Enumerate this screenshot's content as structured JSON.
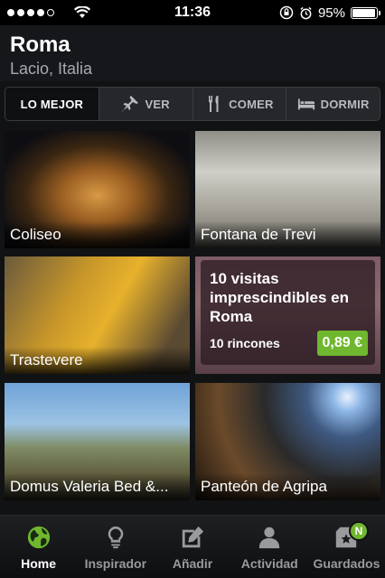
{
  "status_bar": {
    "time": "11:36",
    "battery": "95%",
    "battery_level": 0.95
  },
  "header": {
    "city": "Roma",
    "region": "Lacio, Italia"
  },
  "tabs": [
    {
      "label": "LO MEJOR",
      "icon": "none",
      "active": true
    },
    {
      "label": "VER",
      "icon": "pin-icon",
      "active": false
    },
    {
      "label": "COMER",
      "icon": "fork-knife-icon",
      "active": false
    },
    {
      "label": "DORMIR",
      "icon": "bed-icon",
      "active": false
    }
  ],
  "tiles": [
    {
      "label": "Coliseo"
    },
    {
      "label": "Fontana de Trevi"
    },
    {
      "label": "Trastevere"
    },
    {
      "promo_title": "10 visitas imprescindibles en Roma",
      "count": "10 rincones",
      "price": "0,89 €"
    },
    {
      "label": "Domus Valeria Bed &..."
    },
    {
      "label": "Panteón de Agripa"
    }
  ],
  "tabbar": [
    {
      "label": "Home",
      "icon": "globe-icon",
      "active": true
    },
    {
      "label": "Inspirador",
      "icon": "lightbulb-icon",
      "active": false
    },
    {
      "label": "Añadir",
      "icon": "edit-icon",
      "active": false
    },
    {
      "label": "Actividad",
      "icon": "user-icon",
      "active": false
    },
    {
      "label": "Guardados",
      "icon": "box-star-icon",
      "active": false,
      "badge": "N"
    }
  ],
  "colors": {
    "accent": "#6fb72f",
    "background": "#111214"
  }
}
